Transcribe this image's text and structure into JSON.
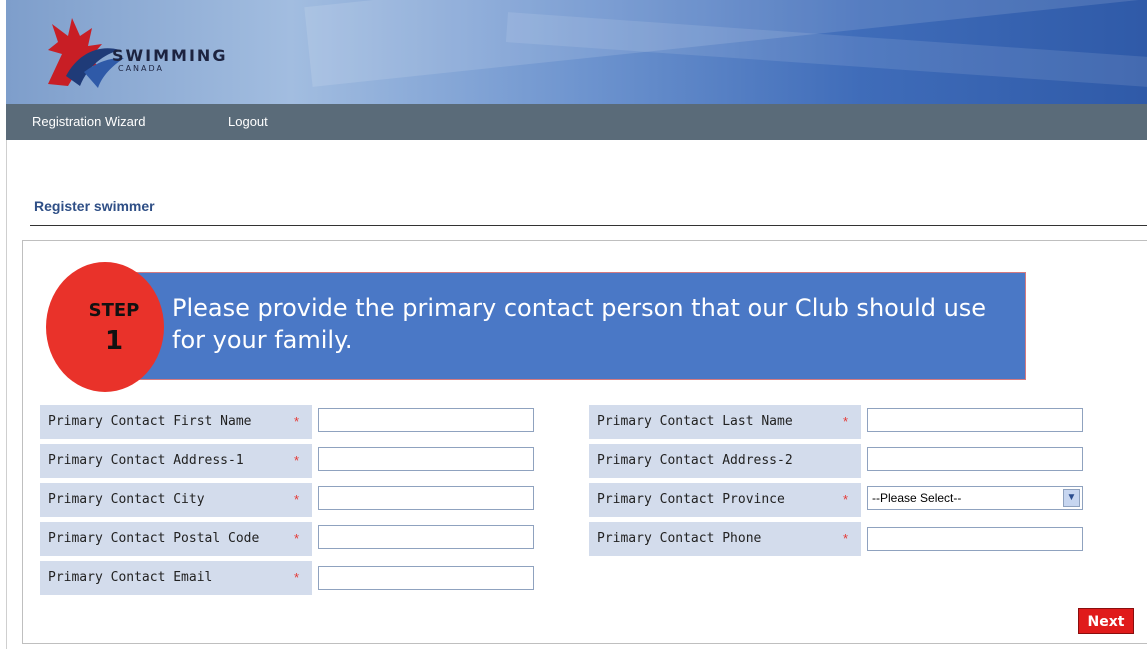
{
  "header": {
    "logo_word": "SWIMMING",
    "logo_sub": "CANADA"
  },
  "nav": {
    "items": [
      "Registration Wizard",
      "Logout"
    ]
  },
  "page": {
    "title": "Register swimmer"
  },
  "step": {
    "word": "STEP",
    "number": "1",
    "text": "Please provide the primary contact person that our Club should use for your family."
  },
  "form": {
    "required_mark": "*",
    "left": [
      {
        "label": "Primary Contact First Name",
        "required": true,
        "value": ""
      },
      {
        "label": "Primary Contact Address-1",
        "required": true,
        "value": ""
      },
      {
        "label": "Primary Contact City",
        "required": true,
        "value": ""
      },
      {
        "label": "Primary Contact Postal Code",
        "required": true,
        "value": ""
      },
      {
        "label": "Primary Contact Email",
        "required": true,
        "value": ""
      }
    ],
    "right": [
      {
        "label": "Primary Contact Last Name",
        "required": true,
        "value": ""
      },
      {
        "label": "Primary Contact Address-2",
        "required": false,
        "value": ""
      },
      {
        "label": "Primary Contact Province",
        "required": true,
        "value": "--Please Select--"
      },
      {
        "label": "Primary Contact Phone",
        "required": true,
        "value": ""
      }
    ],
    "next_label": "Next"
  },
  "colors": {
    "accent": "#4a78c6",
    "step_circle": "#e9322a",
    "next_button": "#e01b1b",
    "label_bg": "#d3dcec"
  }
}
